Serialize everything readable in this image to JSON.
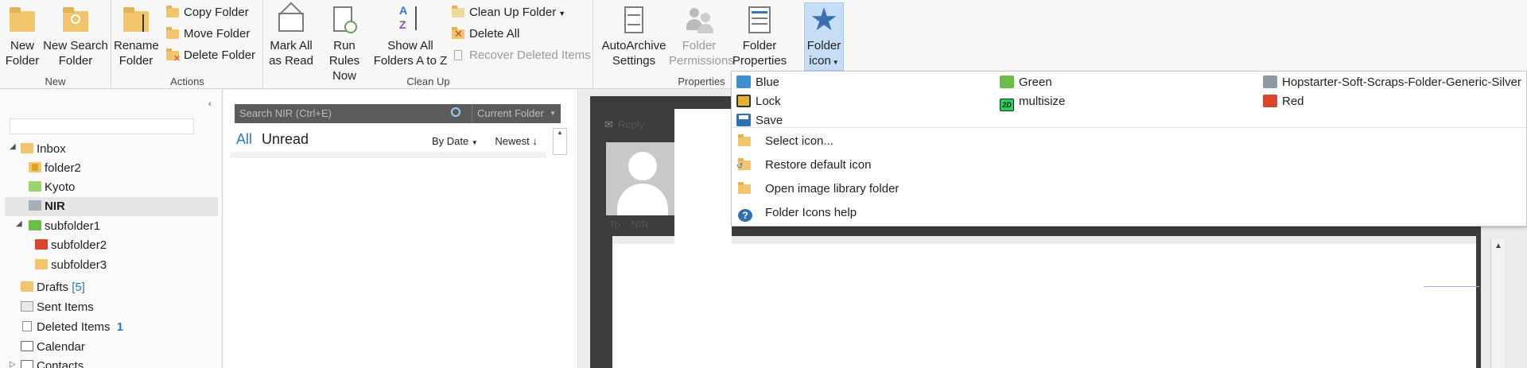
{
  "ribbon": {
    "groups": {
      "new": "New",
      "actions": "Actions",
      "clean_up": "Clean Up",
      "properties": "Properties"
    },
    "new_folder": [
      "New",
      "Folder"
    ],
    "new_search_folder": [
      "New Search",
      "Folder"
    ],
    "rename_folder": [
      "Rename",
      "Folder"
    ],
    "copy_folder": "Copy Folder",
    "move_folder": "Move Folder",
    "delete_folder": "Delete Folder",
    "mark_all_read": [
      "Mark All",
      "as Read"
    ],
    "run_rules_now": [
      "Run Rules",
      "Now"
    ],
    "show_all_folders": [
      "Show All",
      "Folders A to Z"
    ],
    "clean_up_folder": "Clean Up Folder",
    "delete_all": "Delete All",
    "recover_deleted": "Recover Deleted Items",
    "autoarchive": [
      "AutoArchive",
      "Settings"
    ],
    "folder_permissions": [
      "Folder",
      "Permissions"
    ],
    "folder_properties": [
      "Folder",
      "Properties"
    ],
    "folder_icon": [
      "Folder",
      "icon"
    ]
  },
  "nav": {
    "collapse_glyph": "‹",
    "items": {
      "inbox": "Inbox",
      "folder2": "folder2",
      "kyoto": "Kyoto",
      "nir": "NIR",
      "subfolder1": "subfolder1",
      "subfolder2": "subfolder2",
      "subfolder3": "subfolder3",
      "drafts": "Drafts",
      "drafts_count": "[5]",
      "sent": "Sent Items",
      "deleted": "Deleted Items",
      "deleted_count": "1",
      "calendar": "Calendar",
      "contacts": "Contacts"
    }
  },
  "msglist": {
    "search_placeholder": "Search NIR (Ctrl+E)",
    "scope": "Current Folder",
    "tab_all": "All",
    "tab_unread": "Unread",
    "sort_by": "By Date",
    "sort_order": "Newest"
  },
  "reading": {
    "reply": "Reply",
    "to_label": "To",
    "to_value": "NIR"
  },
  "dropdown": {
    "icons": {
      "blue": "Blue",
      "lock": "Lock",
      "save": "Save",
      "green": "Green",
      "multisize": "multisize",
      "silver": "Hopstarter-Soft-Scraps-Folder-Generic-Silver",
      "red": "Red",
      "multisize_badge": "2D"
    },
    "commands": {
      "select_icon": "Select icon...",
      "restore_default": "Restore default icon",
      "open_library": "Open image library folder",
      "help": "Folder Icons help"
    }
  },
  "colors": {
    "accent": "#2a78c5",
    "ribbon_active": "#c6def5",
    "folder": "#f2c46b",
    "green": "#6abf4b",
    "red": "#d9442c",
    "silver": "#8d9aa6",
    "blue": "#3b8fcf"
  }
}
